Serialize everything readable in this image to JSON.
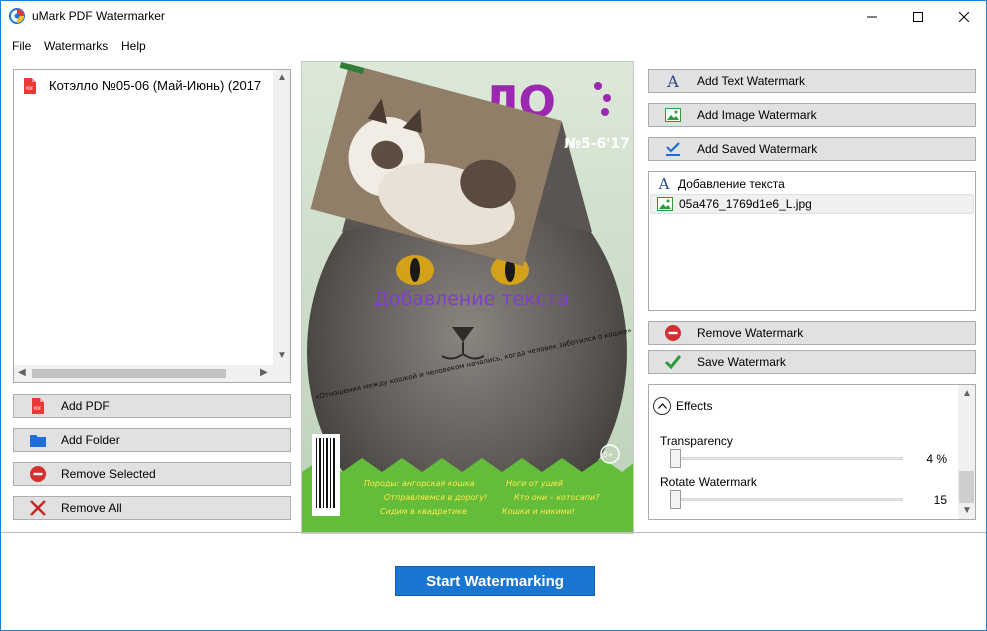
{
  "window": {
    "title": "uMark PDF Watermarker"
  },
  "menu": [
    "File",
    "Watermarks",
    "Help"
  ],
  "files": [
    {
      "name": "Котэлло №05-06 (Май-Июнь) (2017"
    }
  ],
  "left_buttons": {
    "add_pdf": "Add PDF",
    "add_folder": "Add Folder",
    "remove_selected": "Remove Selected",
    "remove_all": "Remove All"
  },
  "preview": {
    "issue": "№5-6'17",
    "watermark_text": "Добавление текста",
    "bottom_items": [
      "Породы: ангорская кошка",
      "Ноги от ушей",
      "Отправляемся в дорогу!",
      "Кто они – котосапи?",
      "Сидим в квадратике",
      "Кошки и никими!"
    ],
    "quote": "«Отношения между кошкой и человеком начались, когда человек заботился о кошке»",
    "age_badge": "0+"
  },
  "right_buttons": {
    "add_text": "Add Text Watermark",
    "add_image": "Add Image Watermark",
    "add_saved": "Add Saved Watermark",
    "remove": "Remove Watermark",
    "save": "Save Watermark"
  },
  "watermarks": [
    {
      "label": "Добавление текста",
      "icon": "text-icon"
    },
    {
      "label": "05a476_1769d1e6_L.jpg",
      "icon": "image-icon"
    }
  ],
  "effects": {
    "title": "Effects",
    "transparency_label": "Transparency",
    "transparency_value": "4 %",
    "transparency": 4,
    "rotate_label": "Rotate Watermark",
    "rotate_value": "15",
    "rotate": 15
  },
  "start_button": "Start Watermarking",
  "colors": {
    "accent": "#1976d2",
    "remove_red": "#d32f2f",
    "save_green": "#2e9b3a",
    "folder_blue": "#1e6fd9"
  }
}
